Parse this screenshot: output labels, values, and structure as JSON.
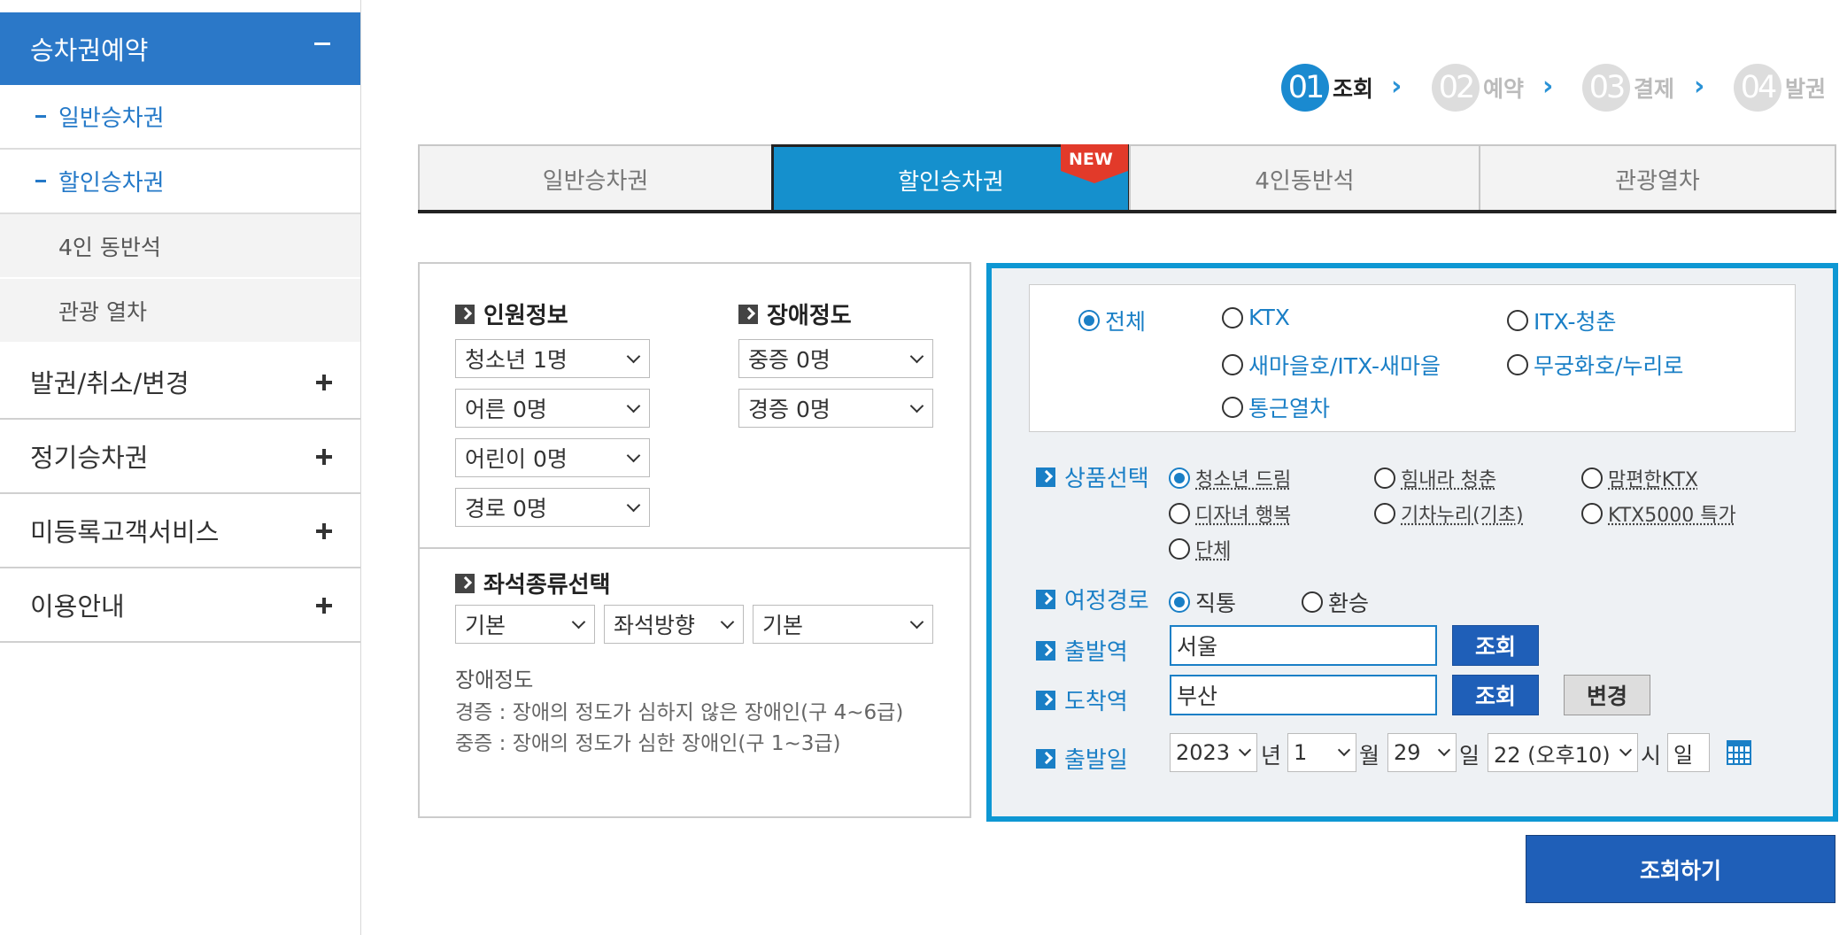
{
  "sidebar": {
    "header": "승차권예약",
    "sub_items": [
      "일반승차권",
      "할인승차권"
    ],
    "gray_items": [
      "4인 동반석",
      "관광 열차"
    ],
    "groups": [
      "발권/취소/변경",
      "정기승차권",
      "미등록고객서비스",
      "이용안내"
    ]
  },
  "steps": [
    {
      "num": "01",
      "label": "조회"
    },
    {
      "num": "02",
      "label": "예약"
    },
    {
      "num": "03",
      "label": "결제"
    },
    {
      "num": "04",
      "label": "발권"
    }
  ],
  "tabs": [
    "일반승차권",
    "할인승차권",
    "4인동반석",
    "관광열차"
  ],
  "new_badge": "NEW",
  "passenger": {
    "title": "인원정보",
    "selects": [
      "청소년 1명",
      "어른 0명",
      "어린이 0명",
      "경로 0명"
    ]
  },
  "disability": {
    "title": "장애정도",
    "selects": [
      "중증 0명",
      "경증 0명"
    ]
  },
  "seat": {
    "title": "좌석종류선택",
    "selects": [
      "기본",
      "좌석방향",
      "기본"
    ]
  },
  "notes": {
    "title": "장애정도",
    "line1": "경증 : 장애의 정도가 심하지 않은 장애인(구 4~6급)",
    "line2": "중증 : 장애의 정도가 심한 장애인(구 1~3급)"
  },
  "train_types": [
    "전체",
    "KTX",
    "ITX-청춘",
    "새마을호/ITX-새마을",
    "무궁화호/누리로",
    "통근열차"
  ],
  "product": {
    "label": "상품선택",
    "options": [
      "청소년 드림",
      "힘내라 청춘",
      "맘편한KTX",
      "디자녀 행복",
      "기차누리(기초)",
      "KTX5000 특가",
      "단체"
    ]
  },
  "route": {
    "label": "여정경로",
    "options": [
      "직통",
      "환승"
    ]
  },
  "departure": {
    "label": "출발역",
    "value": "서울",
    "button": "조회"
  },
  "arrival": {
    "label": "도착역",
    "value": "부산",
    "button": "조회",
    "swap_button": "변경"
  },
  "date": {
    "label": "출발일",
    "year": "2023",
    "year_unit": "년",
    "month": "1",
    "month_unit": "월",
    "day": "29",
    "day_unit": "일",
    "hour": "22 (오후10)",
    "hour_unit": "시",
    "weekday": "일"
  },
  "search_button": "조회하기",
  "colors": {
    "accent": "#1590cd",
    "sidebar_active": "#2b78c8",
    "button": "#1f5fb8"
  }
}
